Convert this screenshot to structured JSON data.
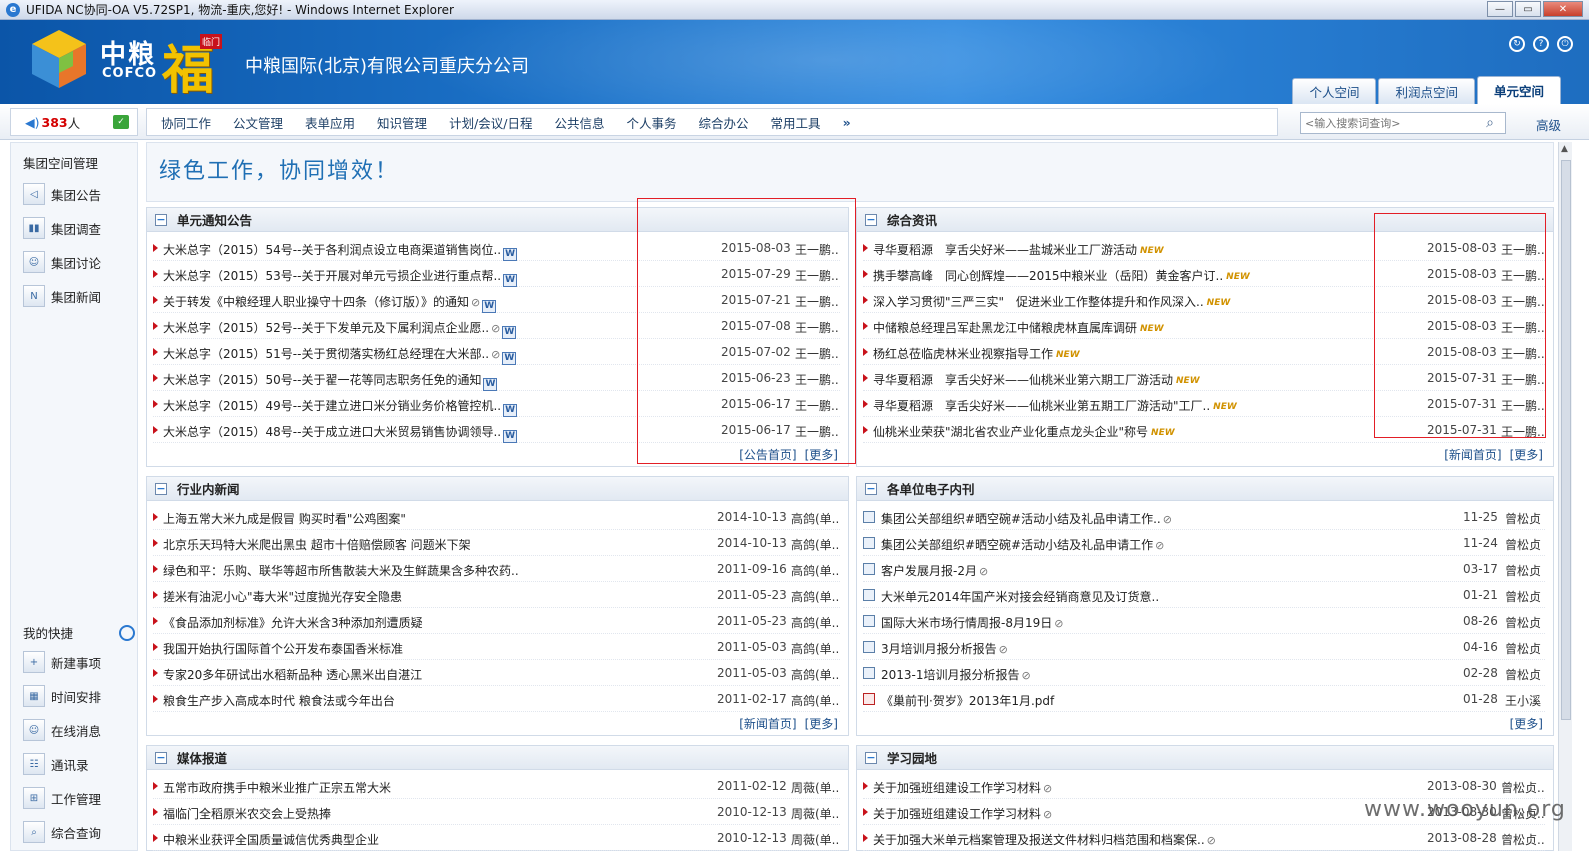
{
  "window": {
    "title": "UFIDA NC协同-OA V5.72SP1, 物流-重庆,您好! - Windows Internet Explorer",
    "buttons": [
      "—",
      "▭",
      "✕"
    ]
  },
  "header": {
    "logo_zh": "中粮",
    "logo_en": "COFCO",
    "logo_fu": "福",
    "logo_fu_tag": "临门",
    "company": "中粮国际(北京)有限公司重庆分公司",
    "tabs": [
      "个人空间",
      "利润点空间",
      "单元空间"
    ],
    "active_tab": "单元空间"
  },
  "nav": {
    "online_count": "383",
    "online_unit": "人",
    "menu": [
      "协同工作",
      "公文管理",
      "表单应用",
      "知识管理",
      "计划/会议/日程",
      "公共信息",
      "个人事务",
      "综合办公",
      "常用工具"
    ],
    "more": "»",
    "search_placeholder": "<输入搜索词查询>",
    "advanced": "高级"
  },
  "sidebar": {
    "group_title": "集团空间管理",
    "group_items": [
      "集团公告",
      "集团调查",
      "集团讨论",
      "集团新闻"
    ],
    "shortcut_title": "我的快捷",
    "shortcut_items": [
      "新建事项",
      "时间安排",
      "在线消息",
      "通讯录",
      "工作管理",
      "综合查询"
    ]
  },
  "banner": {
    "text": "绿色工作，协同增效！"
  },
  "panels": {
    "notices": {
      "title": "单元通知公告",
      "rows": [
        {
          "title": "大米总字（2015）54号--关于各利润点设立电商渠道销售岗位..",
          "date": "2015-08-03",
          "author": "王一鹏.."
        },
        {
          "title": "大米总字（2015）53号--关于开展对单元亏损企业进行重点帮..",
          "date": "2015-07-29",
          "author": "王一鹏.."
        },
        {
          "title": "关于转发《中粮经理人职业操守十四条（修订版）》的通知",
          "date": "2015-07-21",
          "author": "王一鹏.."
        },
        {
          "title": "大米总字（2015）52号--关于下发单元及下属利润点企业愿..",
          "date": "2015-07-08",
          "author": "王一鹏.."
        },
        {
          "title": "大米总字（2015）51号--关于贯彻落实杨红总经理在大米部..",
          "date": "2015-07-02",
          "author": "王一鹏.."
        },
        {
          "title": "大米总字（2015）50号--关于翟一花等同志职务任免的通知",
          "date": "2015-06-23",
          "author": "王一鹏.."
        },
        {
          "title": "大米总字（2015）49号--关于建立进口米分销业务价格管控机..",
          "date": "2015-06-17",
          "author": "王一鹏.."
        },
        {
          "title": "大米总字（2015）48号--关于成立进口大米贸易销售协调领导..",
          "date": "2015-06-17",
          "author": "王一鹏.."
        }
      ],
      "footer": [
        "[公告首页]",
        "[更多]"
      ]
    },
    "news": {
      "title": "综合资讯",
      "rows": [
        {
          "title": "寻华夏稻源　享舌尖好米——盐城米业工厂游活动",
          "date": "2015-08-03",
          "author": "王一鹏.."
        },
        {
          "title": "携手攀高峰　同心创辉煌——2015中粮米业（岳阳）黄金客户订..",
          "date": "2015-08-03",
          "author": "王一鹏.."
        },
        {
          "title": "深入学习贯彻\"三严三实\"　促进米业工作整体提升和作风深入..",
          "date": "2015-08-03",
          "author": "王一鹏.."
        },
        {
          "title": "中储粮总经理吕军赴黑龙江中储粮虎林直属库调研",
          "date": "2015-08-03",
          "author": "王一鹏.."
        },
        {
          "title": "杨红总莅临虎林米业视察指导工作",
          "date": "2015-08-03",
          "author": "王一鹏.."
        },
        {
          "title": "寻华夏稻源　享舌尖好米——仙桃米业第六期工厂游活动",
          "date": "2015-07-31",
          "author": "王一鹏.."
        },
        {
          "title": "寻华夏稻源　享舌尖好米——仙桃米业第五期工厂游活动\"工厂..",
          "date": "2015-07-31",
          "author": "王一鹏.."
        },
        {
          "title": "仙桃米业荣获\"湖北省农业产业化重点龙头企业\"称号",
          "date": "2015-07-31",
          "author": "王一鹏.."
        }
      ],
      "new_tag": "NEW",
      "footer": [
        "[新闻首页]",
        "[更多]"
      ]
    },
    "industry": {
      "title": "行业内新闻",
      "rows": [
        {
          "title": "上海五常大米九成是假冒 购买时看\"公鸡图案\"",
          "date": "2014-10-13",
          "author": "高鸽(单.."
        },
        {
          "title": "北京乐天玛特大米爬出黑虫 超市十倍赔偿顾客 问题米下架",
          "date": "2014-10-13",
          "author": "高鸽(单.."
        },
        {
          "title": "绿色和平：乐购、联华等超市所售散装大米及生鲜蔬果含多种农药..",
          "date": "2011-09-16",
          "author": "高鸽(单.."
        },
        {
          "title": "搓米有油泥小心\"毒大米\"过度抛光存安全隐患",
          "date": "2011-05-23",
          "author": "高鸽(单.."
        },
        {
          "title": "《食品添加剂标准》允许大米含3种添加剂遭质疑",
          "date": "2011-05-23",
          "author": "高鸽(单.."
        },
        {
          "title": "我国开始执行国际首个公开发布泰国香米标准",
          "date": "2011-05-03",
          "author": "高鸽(单.."
        },
        {
          "title": "专家20多年研试出水稻新品种 透心黑米出自湛江",
          "date": "2011-05-03",
          "author": "高鸽(单.."
        },
        {
          "title": "粮食生产步入高成本时代 粮食法或今年出台",
          "date": "2011-02-17",
          "author": "高鸽(单.."
        }
      ],
      "footer": [
        "[新闻首页]",
        "[更多]"
      ]
    },
    "journal": {
      "title": "各单位电子内刊",
      "rows": [
        {
          "title": "集团公关部组织#晒空碗#活动小结及礼品申请工作..",
          "date": "11-25",
          "author": "曾松贞",
          "type": "doc",
          "attach": true
        },
        {
          "title": "集团公关部组织#晒空碗#活动小结及礼品申请工作",
          "date": "11-24",
          "author": "曾松贞",
          "type": "doc",
          "attach": true
        },
        {
          "title": "客户发展月报-2月",
          "date": "03-17",
          "author": "曾松贞",
          "type": "doc",
          "attach": true
        },
        {
          "title": "大米单元2014年国产米对接会经销商意见及订货意..",
          "date": "01-21",
          "author": "曾松贞",
          "type": "doc",
          "attach": false
        },
        {
          "title": "国际大米市场行情周报-8月19日",
          "date": "08-26",
          "author": "曾松贞",
          "type": "doc",
          "attach": true
        },
        {
          "title": "3月培训月报分析报告",
          "date": "04-16",
          "author": "曾松贞",
          "type": "doc",
          "attach": true
        },
        {
          "title": "2013-1培训月报分析报告",
          "date": "02-28",
          "author": "曾松贞",
          "type": "doc",
          "attach": true
        },
        {
          "title": "《巢前刊·贺岁》2013年1月.pdf",
          "date": "01-28",
          "author": "王小溪",
          "type": "pdf",
          "attach": false
        }
      ],
      "footer": [
        "[更多]"
      ]
    },
    "media": {
      "title": "媒体报道",
      "rows": [
        {
          "title": "五常市政府携手中粮米业推广正宗五常大米",
          "date": "2011-02-12",
          "author": "周薇(单.."
        },
        {
          "title": "福临门全稻原米农交会上受热捧",
          "date": "2010-12-13",
          "author": "周薇(单.."
        },
        {
          "title": "中粮米业获评全国质量诚信优秀典型企业",
          "date": "2010-12-13",
          "author": "周薇(单.."
        }
      ]
    },
    "study": {
      "title": "学习园地",
      "rows": [
        {
          "title": "关于加强班组建设工作学习材料",
          "date": "2013-08-30",
          "author": "曾松贞.."
        },
        {
          "title": "关于加强班组建设工作学习材料",
          "date": "2013-08-30",
          "author": "曾松贞.."
        },
        {
          "title": "关于加强大米单元档案管理及报送文件材料归档范围和档案保..",
          "date": "2013-08-28",
          "author": "曾松贞.."
        }
      ]
    }
  },
  "watermark": "www.wooyun.org"
}
